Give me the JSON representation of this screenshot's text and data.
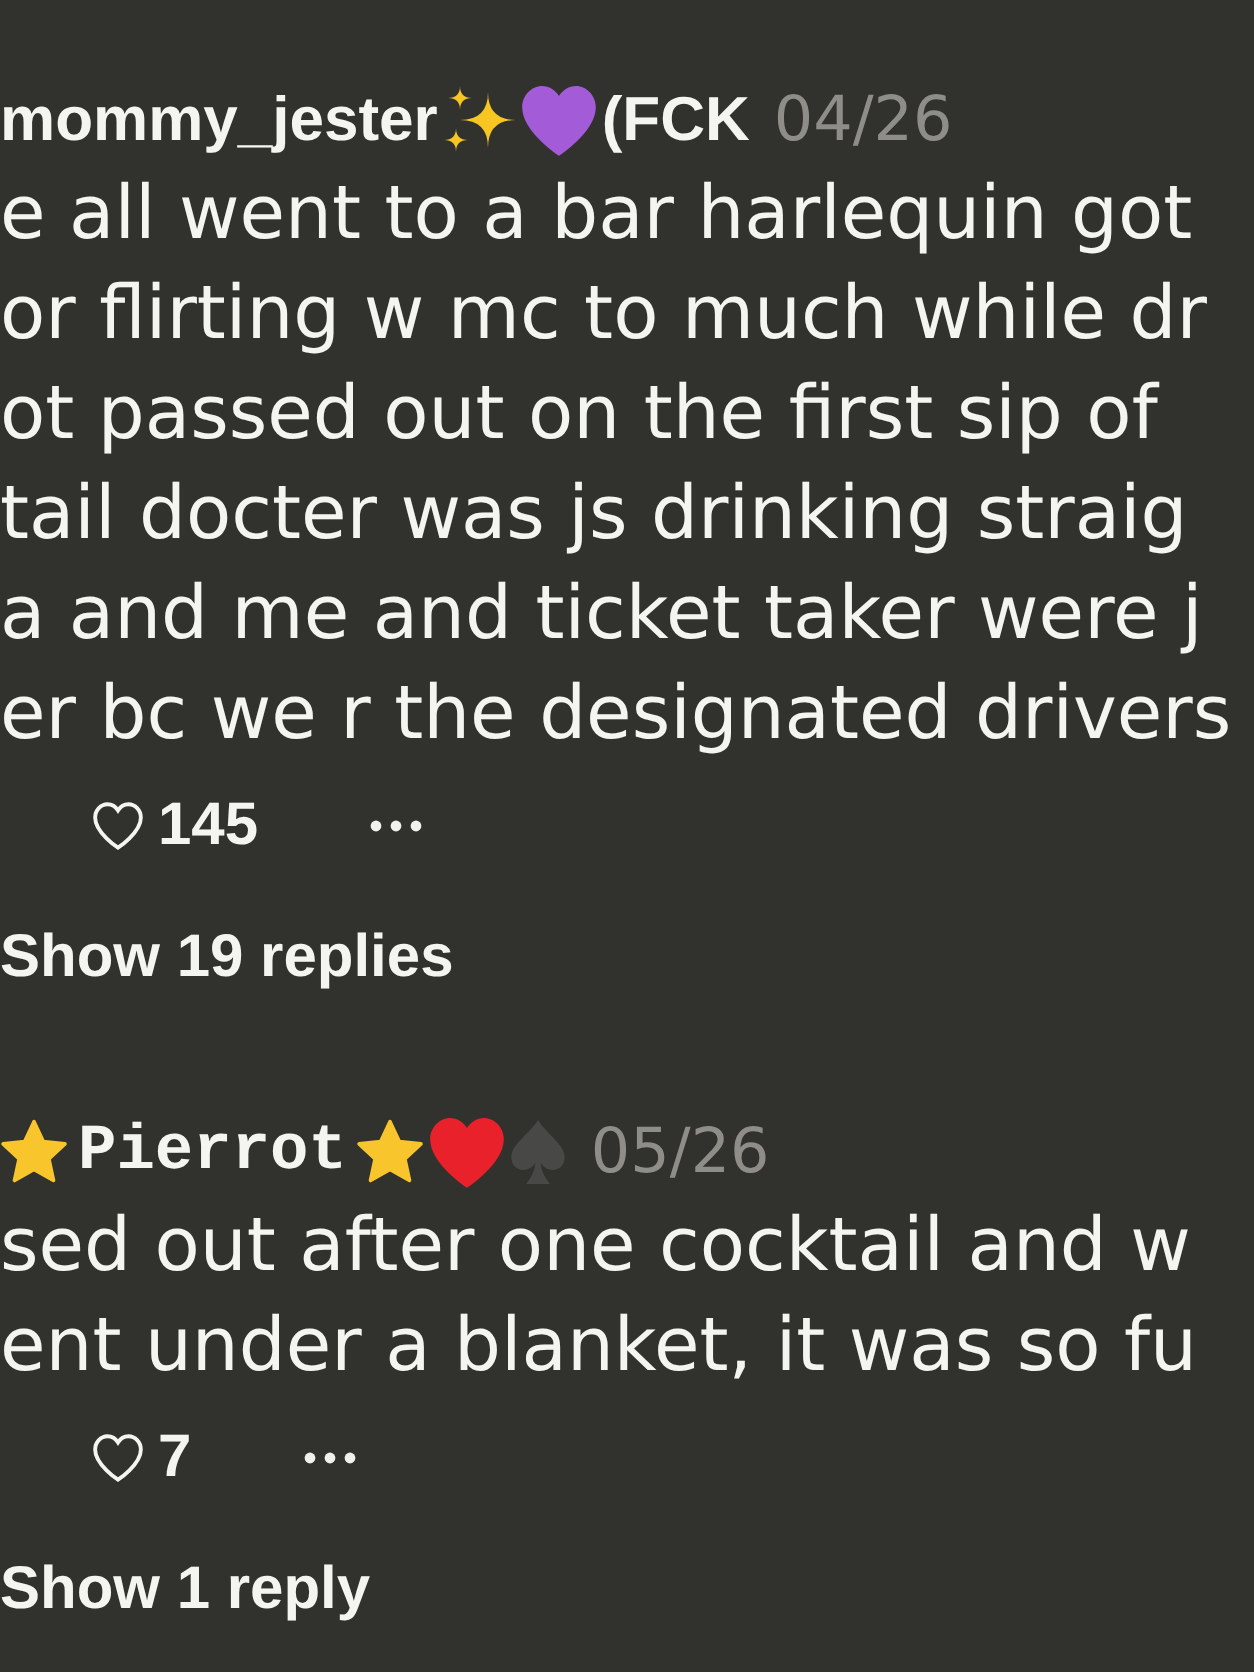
{
  "comments": [
    {
      "author": [
        {
          "kind": "text",
          "text": "mommy_jester"
        },
        {
          "kind": "sparkles"
        },
        {
          "kind": "heart",
          "color": "#a35bd8"
        },
        {
          "kind": "text",
          "text": "(FCK"
        }
      ],
      "date": "04/26",
      "lines": [
        "e all went to a bar harlequin got",
        "or flirting w mc to much while dr",
        "ot passed out on the first sip of",
        "tail docter was js drinking straig",
        "a and me and ticket taker were j",
        "er bc we r the designated drivers"
      ],
      "liked": false,
      "likes": "145",
      "replies": "Show 19 replies"
    },
    {
      "author": [
        {
          "kind": "star"
        },
        {
          "kind": "mono",
          "text": "Pierrot"
        },
        {
          "kind": "star"
        },
        {
          "kind": "heart",
          "color": "#e8212b"
        },
        {
          "kind": "spade"
        }
      ],
      "date": "05/26",
      "lines": [
        "sed out after one cocktail and w",
        "ent under a blanket, it was so fu"
      ],
      "liked": false,
      "likes": "7",
      "replies": "Show 1 reply"
    }
  ]
}
